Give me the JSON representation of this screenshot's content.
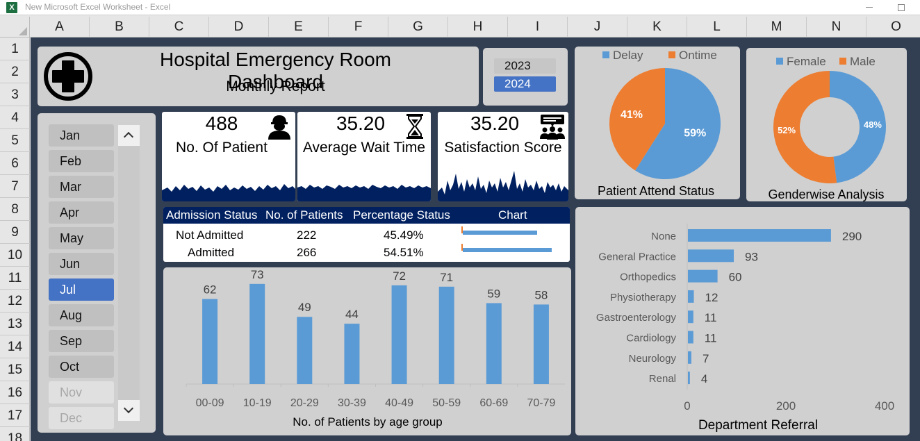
{
  "window": {
    "title": "New Microsoft Excel Worksheet - Excel",
    "app_icon": "excel-logo-icon"
  },
  "columns": [
    "A",
    "B",
    "C",
    "D",
    "E",
    "F",
    "G",
    "H",
    "I",
    "J",
    "K",
    "L",
    "M",
    "N",
    "O"
  ],
  "rows": [
    "1",
    "2",
    "3",
    "4",
    "5",
    "6",
    "7",
    "8",
    "9",
    "10",
    "11",
    "12",
    "13",
    "14",
    "15",
    "16",
    "17",
    "18"
  ],
  "dashboard": {
    "title": "Hospital Emergency Room Dashboard",
    "subtitle": "Monthly Report",
    "logo_icon": "medical-cross-icon"
  },
  "years": [
    {
      "label": "2023",
      "selected": false
    },
    {
      "label": "2024",
      "selected": true
    }
  ],
  "months": [
    {
      "label": "Jan",
      "state": "normal"
    },
    {
      "label": "Feb",
      "state": "normal"
    },
    {
      "label": "Mar",
      "state": "normal"
    },
    {
      "label": "Apr",
      "state": "normal"
    },
    {
      "label": "May",
      "state": "normal"
    },
    {
      "label": "Jun",
      "state": "normal"
    },
    {
      "label": "Jul",
      "state": "selected"
    },
    {
      "label": "Aug",
      "state": "normal"
    },
    {
      "label": "Sep",
      "state": "normal"
    },
    {
      "label": "Oct",
      "state": "normal"
    },
    {
      "label": "Nov",
      "state": "disabled"
    },
    {
      "label": "Dec",
      "state": "disabled"
    }
  ],
  "kpis": {
    "patients": {
      "value": "488",
      "label": "No. Of Patient",
      "icon": "doctor-icon"
    },
    "wait": {
      "value": "35.20",
      "label": "Average Wait Time",
      "icon": "hourglass-icon"
    },
    "satisfaction": {
      "value": "35.20",
      "label": "Satisfaction Score",
      "icon": "audience-feedback-icon"
    }
  },
  "admission": {
    "headers": [
      "Admission Status",
      "No. of Patients",
      "Percentage Status",
      "Chart"
    ],
    "rows": [
      {
        "status": "Not Admitted",
        "count": "222",
        "percent": "45.49%",
        "fraction": 0.4549
      },
      {
        "status": "Admitted",
        "count": "266",
        "percent": "54.51%",
        "fraction": 0.5451
      }
    ]
  },
  "colors": {
    "bar_blue": "#5b9bd5",
    "orange": "#ed7d31",
    "navy": "#002060",
    "sheet_bg": "#323e52",
    "panel_grey": "#d0d0d0",
    "selected_blue": "#4472c4"
  },
  "chart_data": [
    {
      "type": "bar",
      "title": "No. of Patients by age group",
      "categories": [
        "00-09",
        "10-19",
        "20-29",
        "30-39",
        "40-49",
        "50-59",
        "60-69",
        "70-79"
      ],
      "values": [
        62,
        73,
        49,
        44,
        72,
        71,
        59,
        58
      ],
      "ylim": [
        0,
        80
      ],
      "grid": false
    },
    {
      "type": "pie",
      "title": "Patient Attend Status",
      "legend": [
        "Delay",
        "Ontime"
      ],
      "legend_position": "top",
      "slices": [
        {
          "name": "Delay",
          "value": 59,
          "label": "59%"
        },
        {
          "name": "Ontime",
          "value": 41,
          "label": "41%"
        }
      ]
    },
    {
      "type": "pie",
      "title": "Genderwise Analysis",
      "donut": true,
      "legend": [
        "Female",
        "Male"
      ],
      "legend_position": "top",
      "slices": [
        {
          "name": "Female",
          "value": 48,
          "label": "48%"
        },
        {
          "name": "Male",
          "value": 52,
          "label": "52%"
        }
      ]
    },
    {
      "type": "bar",
      "orientation": "horizontal",
      "title": "Department Referral",
      "categories": [
        "None",
        "General Practice",
        "Orthopedics",
        "Physiotherapy",
        "Gastroenterology",
        "Cardiology",
        "Neurology",
        "Renal"
      ],
      "values": [
        290,
        93,
        60,
        12,
        11,
        11,
        7,
        4
      ],
      "xlim": [
        0,
        400
      ],
      "xticks": [
        "0",
        "200",
        "400"
      ],
      "grid": false
    }
  ]
}
